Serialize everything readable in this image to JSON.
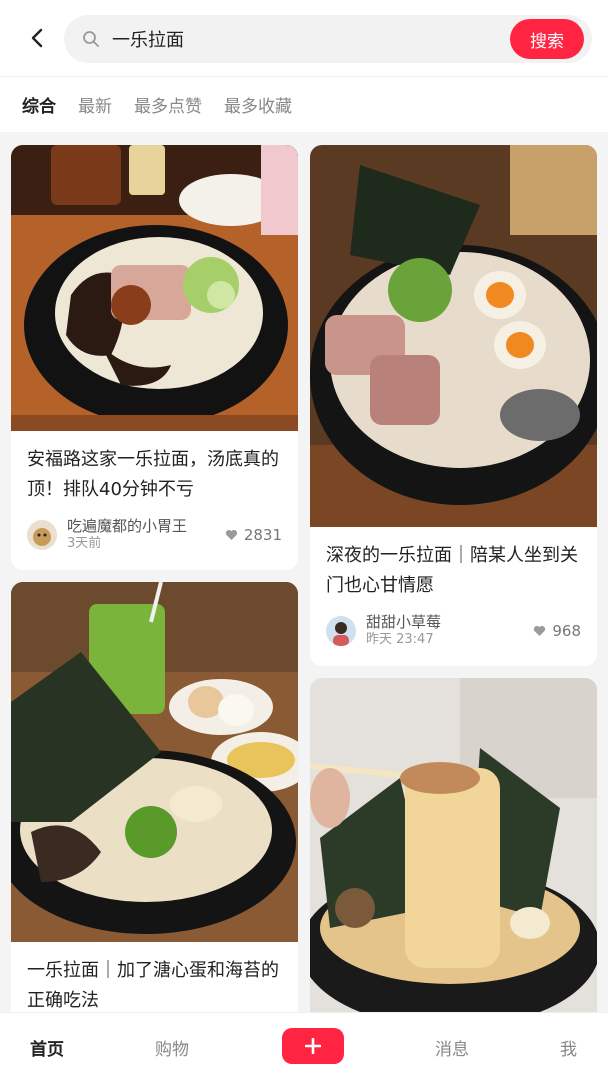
{
  "header": {
    "search_value": "一乐拉面",
    "search_button": "搜索"
  },
  "tabs": [
    {
      "label": "综合",
      "active": true
    },
    {
      "label": "最新",
      "active": false
    },
    {
      "label": "最多点赞",
      "active": false
    },
    {
      "label": "最多收藏",
      "active": false
    }
  ],
  "feed": [
    {
      "title": "安福路这家一乐拉面，汤底真的顶！排队40分钟不亏",
      "author": "吃遍魔都的小胃王",
      "time": "3天前",
      "likes": "2831"
    },
    {
      "title": "深夜的一乐拉面｜陪某人坐到关门也心甘情愿",
      "author": "甜甜小草莓",
      "time": "昨天 23:47",
      "likes": "968"
    },
    {
      "title": "一乐拉面｜加了溏心蛋和海苔的正确吃法",
      "author": "",
      "time": "",
      "likes": ""
    },
    {
      "title": "",
      "author": "",
      "time": "",
      "likes": ""
    }
  ],
  "bottom_nav": {
    "home": "首页",
    "shop": "购物",
    "plus": "+",
    "messages": "消息",
    "me": "我"
  },
  "colors": {
    "accent": "#ff2442",
    "background": "#f4f4f4"
  }
}
